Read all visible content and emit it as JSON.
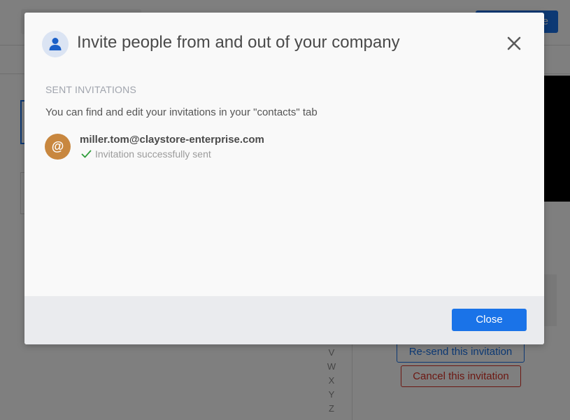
{
  "background": {
    "topbar_button_label": "e",
    "alphabet": [
      "V",
      "W",
      "X",
      "Y",
      "Z"
    ],
    "resend_label": "Re-send this invitation",
    "cancel_label": "Cancel this invitation"
  },
  "modal": {
    "title": "Invite people from and out of your company",
    "section_label": "SENT INVITATIONS",
    "info_text": "You can find and edit your invitations in your \"contacts\" tab",
    "invitations": [
      {
        "avatar_symbol": "@",
        "email": "miller.tom@claystore-enterprise.com",
        "status": "Invitation successfully sent"
      }
    ],
    "close_button_label": "Close"
  },
  "colors": {
    "primary": "#1a73e8",
    "danger": "#d93025",
    "avatar_orange": "#c8873f",
    "success_check": "#2e9d3a",
    "footer_bg": "#eaebee"
  },
  "icons": {
    "header": "user-icon",
    "close": "close-icon",
    "status": "check-icon"
  }
}
